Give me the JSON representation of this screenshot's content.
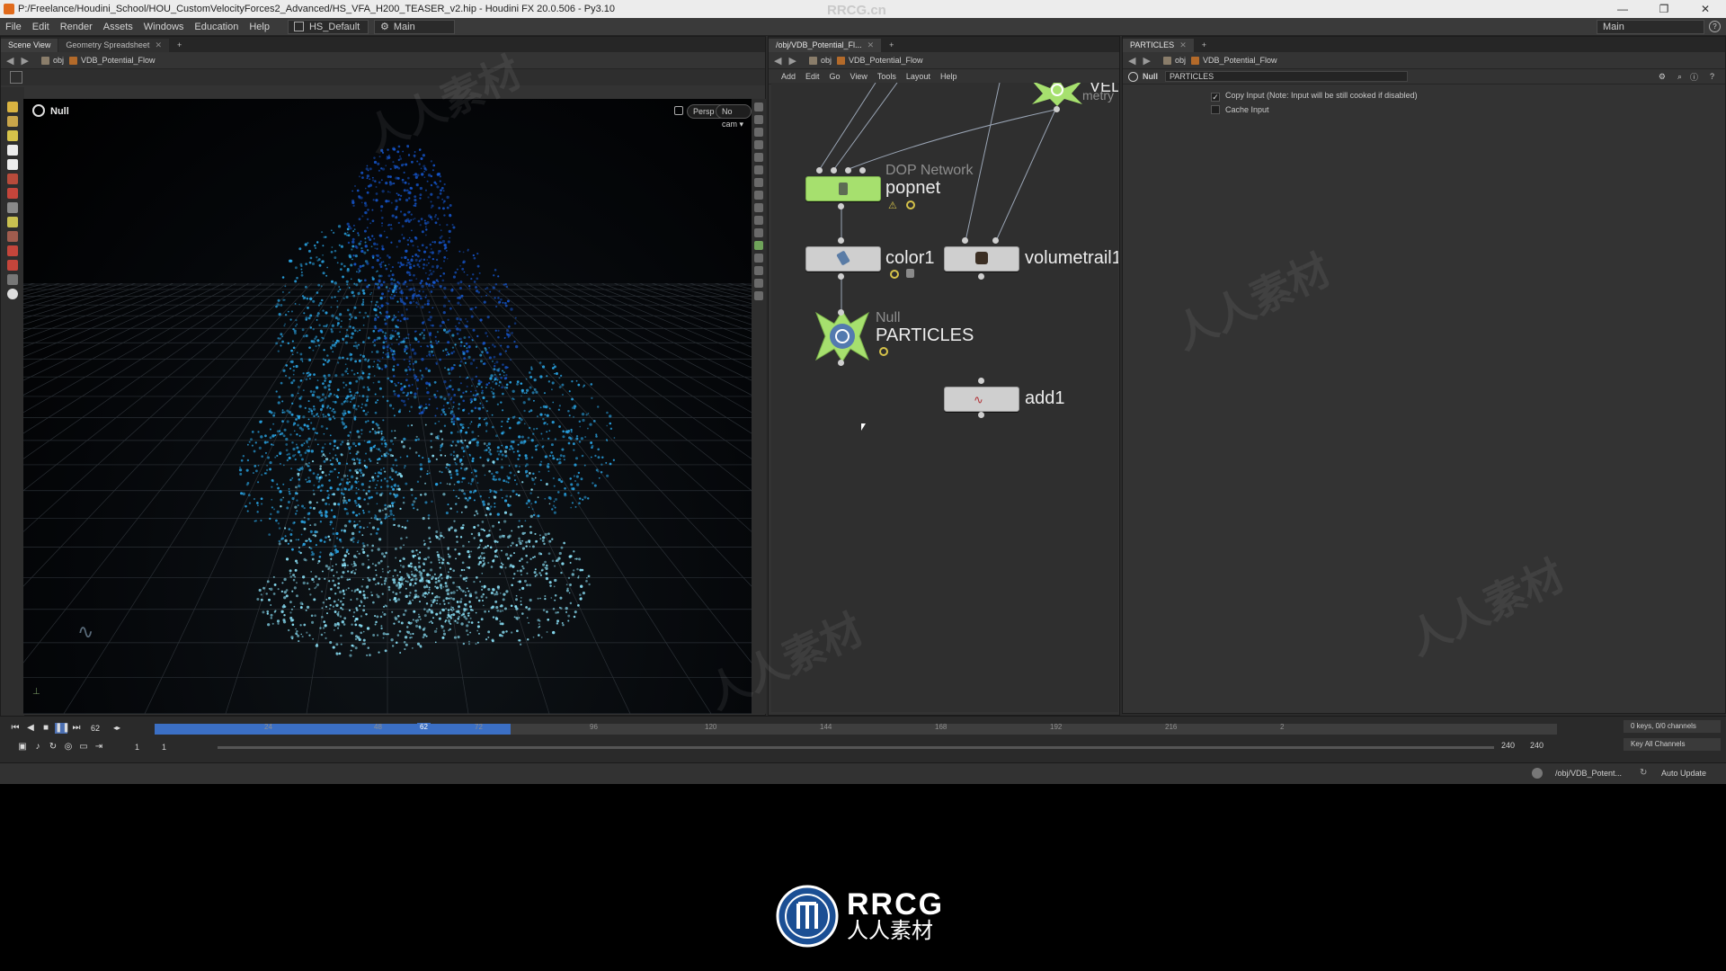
{
  "window": {
    "title": "P:/Freelance/Houdini_School/HOU_CustomVelocityForces2_Advanced/HS_VFA_H200_TEASER_v2.hip - Houdini FX 20.0.506 - Py3.10",
    "controls": [
      "—",
      "❐",
      "✕"
    ]
  },
  "menubar": {
    "items": [
      "File",
      "Edit",
      "Render",
      "Assets",
      "Windows",
      "Education",
      "Help"
    ],
    "desktop": "HS_Default",
    "shelf_set": "Main",
    "right_shelf": "Main"
  },
  "left_pane": {
    "tabs": [
      "Scene View",
      "Geometry Spreadsheet"
    ],
    "path": [
      "obj",
      "VDB_Potential_Flow"
    ],
    "viewport_label": "Null",
    "camera_mode": "Persp",
    "camera": "No cam"
  },
  "network_pane": {
    "tab": "/obj/VDB_Potential_Fl...",
    "path": [
      "obj",
      "VDB_Potential_Flow"
    ],
    "menu": [
      "Add",
      "Edit",
      "Go",
      "View",
      "Tools",
      "Layout",
      "Help"
    ],
    "nodes": [
      {
        "name": "VEL",
        "type": "",
        "color": "#a6e06e"
      },
      {
        "name": "popnet",
        "type": "DOP Network",
        "color": "#a6e06e"
      },
      {
        "name": "color1",
        "type": "",
        "color": "#cfcfcf"
      },
      {
        "name": "volumetrail1",
        "type": "",
        "color": "#cfcfcf"
      },
      {
        "name": "PARTICLES",
        "type": "Null",
        "color": "#a6e06e"
      },
      {
        "name": "add1",
        "type": "",
        "color": "#cfcfcf"
      }
    ],
    "partial_label": "metry"
  },
  "param_pane": {
    "tab": "PARTICLES",
    "path": [
      "obj",
      "VDB_Potential_Flow"
    ],
    "node_type": "Null",
    "node_name": "PARTICLES",
    "params": [
      {
        "label": "Copy Input (Note: Input will be still cooked if disabled)",
        "checked": true
      },
      {
        "label": "Cache Input",
        "checked": false
      }
    ]
  },
  "timeline": {
    "current_frame": "62",
    "start_frame": "1",
    "range_start": "1",
    "range_end": "240",
    "end_frame": "240",
    "ticks": [
      "24",
      "48",
      "62",
      "72",
      "96",
      "120",
      "144",
      "168",
      "192",
      "216",
      "2"
    ],
    "keys_info": "0 keys, 0/0 channels",
    "key_all": "Key All Channels",
    "playhead_fraction": 0.254
  },
  "statusbar": {
    "path": "/obj/VDB_Potent...",
    "update_mode": "Auto Update"
  },
  "watermark": {
    "top_text": "RRCG.cn",
    "logo_text": "RRCG",
    "logo_sub": "人人素材",
    "tile_text": "人人素材"
  },
  "colors": {
    "particle_bright": "#8fe8ff",
    "particle_mid": "#2aa7e8",
    "particle_deep": "#1554c8",
    "node_green": "#a6e06e",
    "playhead": "#3b6fc4"
  }
}
